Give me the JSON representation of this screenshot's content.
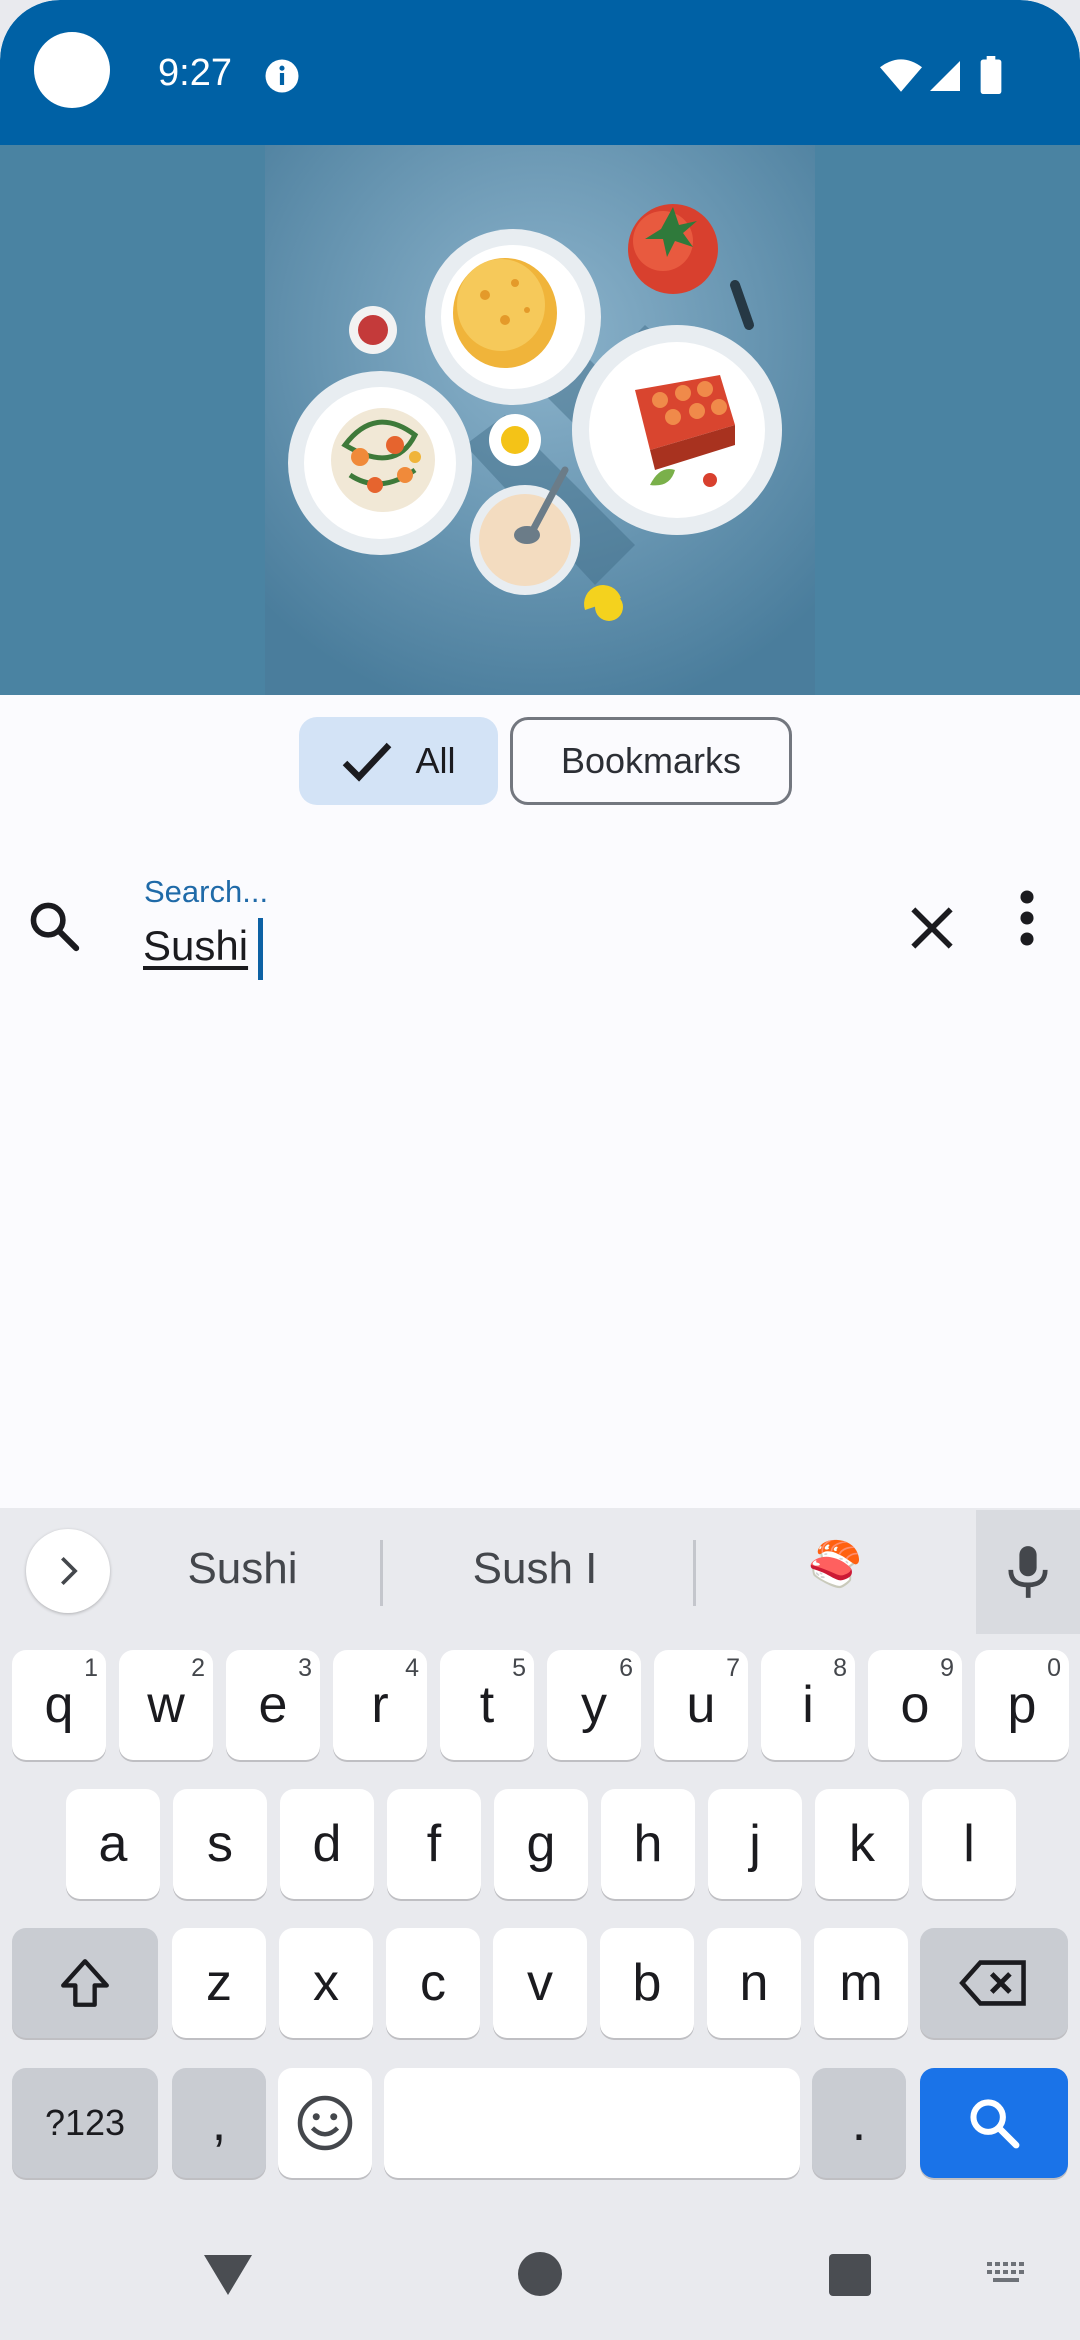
{
  "status_bar": {
    "time": "9:27",
    "background_color": "#0061a5",
    "icons": [
      "camera-cutout",
      "info-icon",
      "wifi-icon",
      "signal-icon",
      "battery-icon"
    ]
  },
  "hero": {
    "image": "food-illustration",
    "background_color": "#4a83a2"
  },
  "filters": {
    "all_label": "All",
    "all_selected": true,
    "bookmarks_label": "Bookmarks"
  },
  "search": {
    "label": "Search...",
    "value": "Sushi",
    "icons": [
      "search-icon",
      "clear-icon",
      "more-vert-icon"
    ]
  },
  "keyboard": {
    "suggestions": [
      "Sushi",
      "Sush I"
    ],
    "emoji_suggestion": "🍣",
    "row1": [
      {
        "k": "q",
        "h": "1"
      },
      {
        "k": "w",
        "h": "2"
      },
      {
        "k": "e",
        "h": "3"
      },
      {
        "k": "r",
        "h": "4"
      },
      {
        "k": "t",
        "h": "5"
      },
      {
        "k": "y",
        "h": "6"
      },
      {
        "k": "u",
        "h": "7"
      },
      {
        "k": "i",
        "h": "8"
      },
      {
        "k": "o",
        "h": "9"
      },
      {
        "k": "p",
        "h": "0"
      }
    ],
    "row2": [
      "a",
      "s",
      "d",
      "f",
      "g",
      "h",
      "j",
      "k",
      "l"
    ],
    "row3": [
      "z",
      "x",
      "c",
      "v",
      "b",
      "n",
      "m"
    ],
    "symbols_label": "?123",
    "comma_label": ",",
    "period_label": ".",
    "action_color": "#1a73e8"
  },
  "nav_bar": {
    "icons": [
      "back-icon",
      "home-icon",
      "recents-icon",
      "keyboard-switch-icon"
    ]
  }
}
